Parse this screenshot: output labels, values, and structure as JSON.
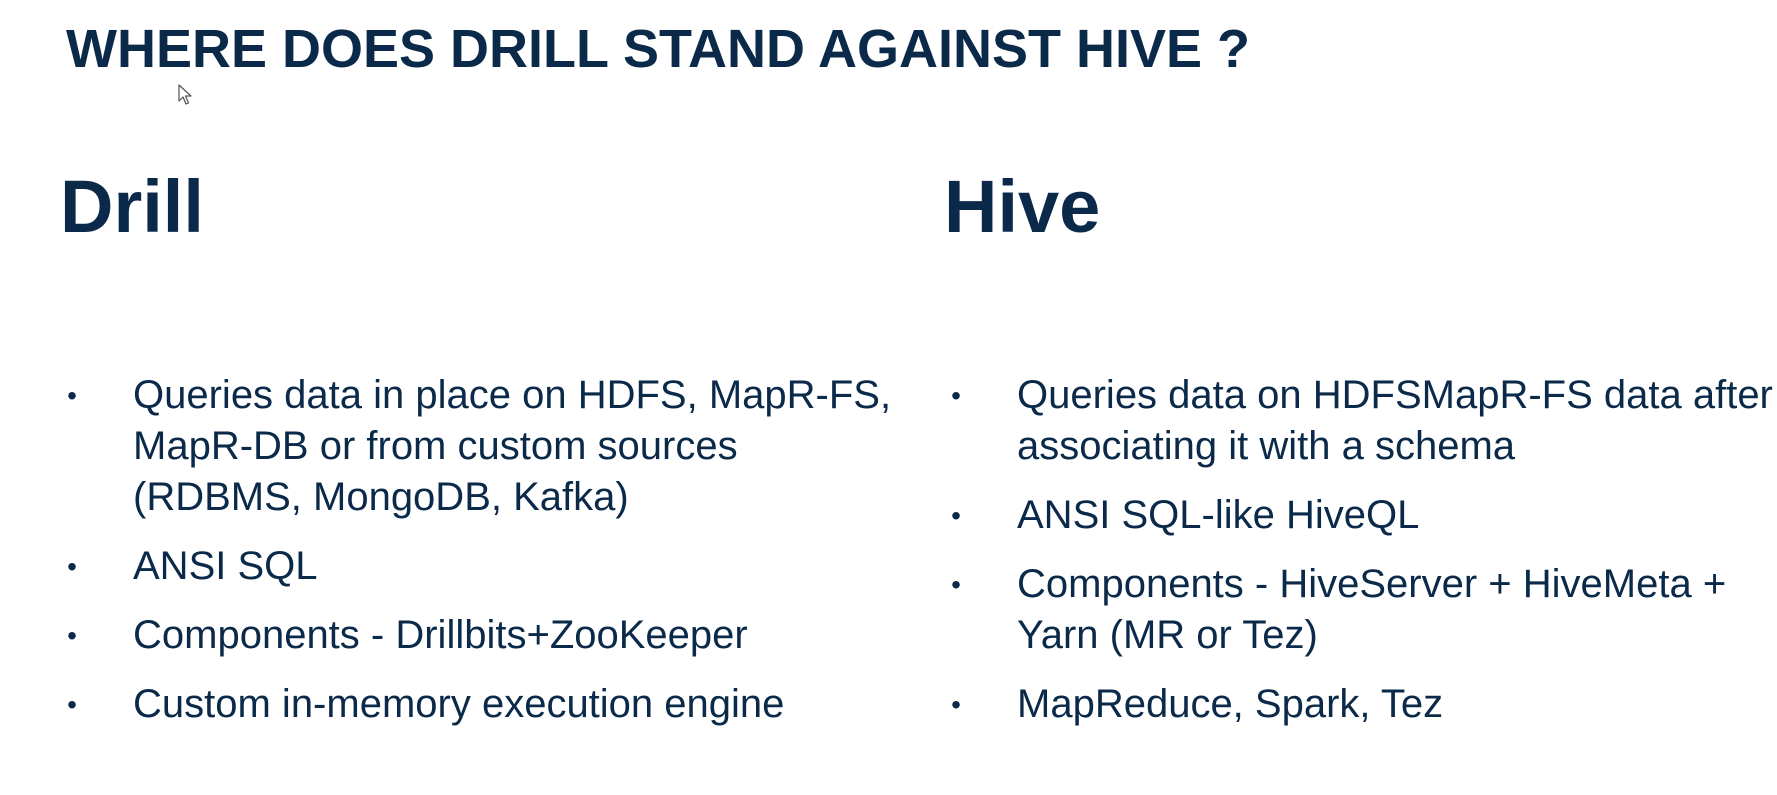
{
  "slide": {
    "title": "WHERE DOES DRILL STAND AGAINST HIVE ?"
  },
  "columns": [
    {
      "heading": "Drill",
      "bullets": [
        "Queries data in place on HDFS, MapR-FS, MapR-DB or from custom sources (RDBMS, MongoDB, Kafka)",
        "ANSI SQL",
        "Components - Drillbits+ZooKeeper",
        "Custom in-memory execution engine"
      ]
    },
    {
      "heading": "Hive",
      "bullets": [
        "Queries data on HDFSMapR-FS data after associating it with a schema",
        "ANSI SQL-like HiveQL",
        "Components - HiveServer + HiveMeta + Yarn (MR or Tez)",
        "MapReduce, Spark, Tez"
      ]
    }
  ],
  "bullet_glyph": "•",
  "icons": {
    "cursor": "mouse-pointer-icon"
  },
  "colors": {
    "text": "#0b2a4a",
    "background": "#ffffff"
  }
}
